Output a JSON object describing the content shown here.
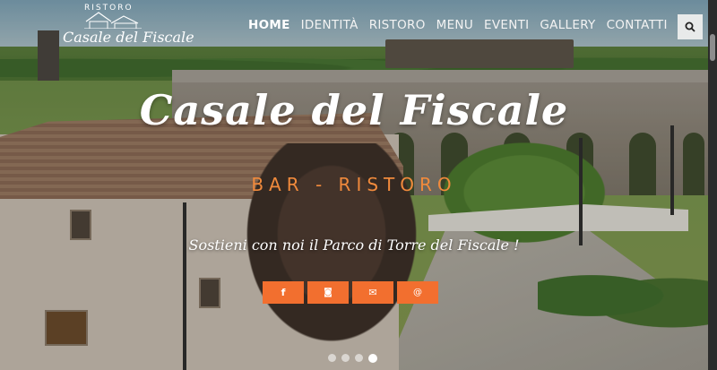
{
  "brand": {
    "logo_small_text": "RISTORO",
    "logo_name": "Casale del Fiscale"
  },
  "nav": {
    "items": [
      {
        "label": "HOME",
        "active": true
      },
      {
        "label": "IDENTITÀ",
        "active": false
      },
      {
        "label": "RISTORO",
        "active": false
      },
      {
        "label": "MENU",
        "active": false
      },
      {
        "label": "EVENTI",
        "active": false
      },
      {
        "label": "GALLERY",
        "active": false
      },
      {
        "label": "CONTATTI",
        "active": false
      }
    ],
    "search_icon": "search-icon"
  },
  "hero": {
    "title": "Casale del Fiscale",
    "subtitle": "BAR - RISTORO",
    "tagline": "Sostieni con noi il Parco di Torre del Fiscale !",
    "social_buttons": [
      {
        "icon": "facebook-icon",
        "glyph": "f"
      },
      {
        "icon": "instagram-icon",
        "glyph": "◙"
      },
      {
        "icon": "envelope-icon",
        "glyph": "✉"
      },
      {
        "icon": "at-icon",
        "glyph": "@"
      }
    ],
    "slides_total": 4,
    "active_slide": 4
  },
  "colors": {
    "accent": "#f26f2f",
    "subtitle": "#f08a3c",
    "text": "#ffffff"
  }
}
